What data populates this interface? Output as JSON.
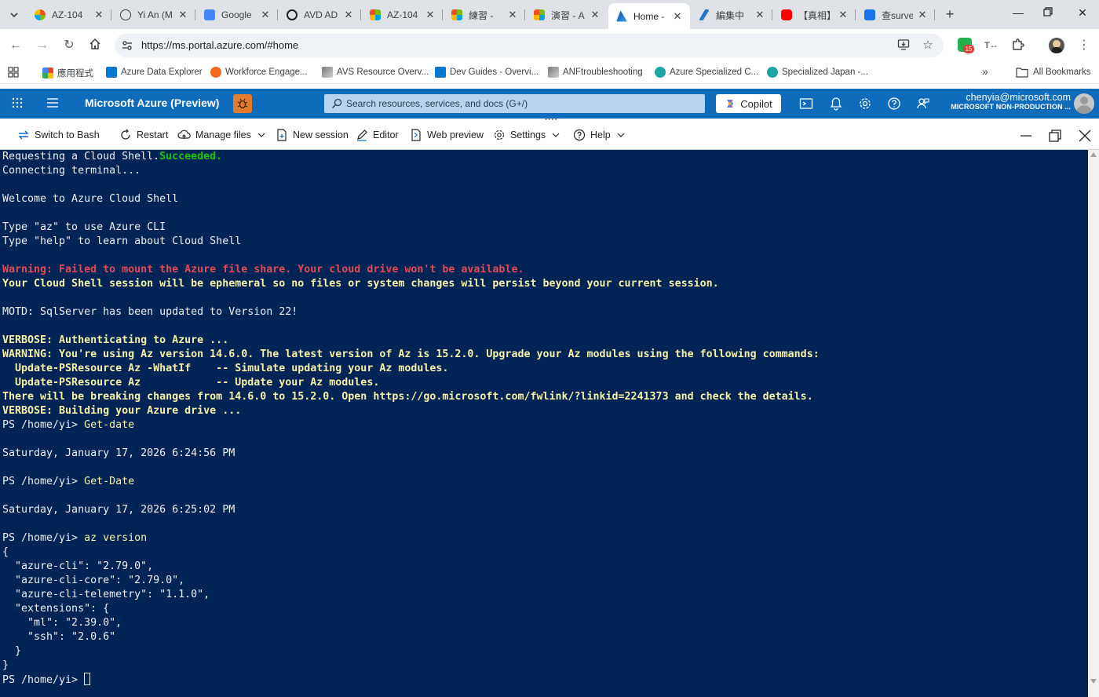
{
  "browser": {
    "tabs": [
      {
        "title": "AZ-104",
        "icon": "azure-multicolor-icon"
      },
      {
        "title": "Yi An (M",
        "icon": "globe-icon"
      },
      {
        "title": "Google",
        "icon": "google-translate-icon"
      },
      {
        "title": "AVD AD",
        "icon": "openai-icon"
      },
      {
        "title": "AZ-104",
        "icon": "microsoft-icon"
      },
      {
        "title": "練習 - ",
        "icon": "microsoft-icon"
      },
      {
        "title": "演習 - A",
        "icon": "microsoft-icon"
      },
      {
        "title": "Home -",
        "icon": "azure-icon",
        "active": true
      },
      {
        "title": "編集中",
        "icon": "azure-edit-icon"
      },
      {
        "title": "【真相】",
        "icon": "youtube-icon"
      },
      {
        "title": "查surve",
        "icon": "forms-icon"
      }
    ],
    "address": {
      "url": "https://ms.portal.azure.com/#home"
    },
    "extension_badge": "15",
    "bookmarks": [
      {
        "label": "應用程式",
        "icon": "apps-grid-icon"
      },
      {
        "label": "Azure Data Explorer",
        "icon": "azure-data-explorer-icon"
      },
      {
        "label": "Workforce Engage...",
        "icon": "workforce-icon"
      },
      {
        "label": "AVS Resource Overv...",
        "icon": "avs-icon"
      },
      {
        "label": "Dev Guides - Overvi...",
        "icon": "devops-icon"
      },
      {
        "label": "ANFtroubleshooting",
        "icon": "anf-icon"
      },
      {
        "label": "Azure Specialized C...",
        "icon": "teal-icon"
      },
      {
        "label": "Specialized Japan -...",
        "icon": "teal-icon"
      }
    ],
    "all_bookmarks_label": "All Bookmarks",
    "more_bookmarks": "»"
  },
  "azure": {
    "brand": "Microsoft Azure (Preview)",
    "search_placeholder": "Search resources, services, and docs (G+/)",
    "copilot_label": "Copilot",
    "user_email": "chenyia@microsoft.com",
    "tenant": "MICROSOFT NON-PRODUCTION ...",
    "colors": {
      "header_bg": "#0f6cbd",
      "terminal_bg": "#012456"
    }
  },
  "cloudshell": {
    "toolbar": {
      "switch": "Switch to Bash",
      "restart": "Restart",
      "manage_files": "Manage files",
      "new_session": "New session",
      "editor": "Editor",
      "web_preview": "Web preview",
      "settings": "Settings",
      "help": "Help"
    },
    "terminal": {
      "lines": [
        {
          "segments": [
            {
              "text": "Requesting a Cloud Shell.",
              "style": "default"
            },
            {
              "text": "Succeeded.",
              "style": "success"
            }
          ]
        },
        {
          "segments": [
            {
              "text": "Connecting terminal...",
              "style": "default"
            }
          ]
        },
        {
          "segments": [
            {
              "text": "",
              "style": "default"
            }
          ]
        },
        {
          "segments": [
            {
              "text": "Welcome to Azure Cloud Shell",
              "style": "default"
            }
          ]
        },
        {
          "segments": [
            {
              "text": "",
              "style": "default"
            }
          ]
        },
        {
          "segments": [
            {
              "text": "Type \"az\" to use Azure CLI",
              "style": "default"
            }
          ]
        },
        {
          "segments": [
            {
              "text": "Type \"help\" to learn about Cloud Shell",
              "style": "default"
            }
          ]
        },
        {
          "segments": [
            {
              "text": "",
              "style": "default"
            }
          ]
        },
        {
          "segments": [
            {
              "text": "Warning: Failed to mount the Azure file share. Your cloud drive won't be available.",
              "style": "red"
            }
          ]
        },
        {
          "segments": [
            {
              "text": "Your Cloud Shell session will be ephemeral so no files or system changes will persist beyond your current session.",
              "style": "yellow"
            }
          ]
        },
        {
          "segments": [
            {
              "text": "",
              "style": "default"
            }
          ]
        },
        {
          "segments": [
            {
              "text": "MOTD: SqlServer has been updated to Version 22!",
              "style": "default"
            }
          ]
        },
        {
          "segments": [
            {
              "text": "",
              "style": "default"
            }
          ]
        },
        {
          "segments": [
            {
              "text": "VERBOSE: Authenticating to Azure ...",
              "style": "yellow"
            }
          ]
        },
        {
          "segments": [
            {
              "text": "WARNING: You're using Az version 14.6.0. The latest version of Az is 15.2.0. Upgrade your Az modules using the following commands:",
              "style": "yellow"
            }
          ]
        },
        {
          "segments": [
            {
              "text": "  Update-PSResource Az -WhatIf    -- Simulate updating your Az modules.",
              "style": "yellow"
            }
          ]
        },
        {
          "segments": [
            {
              "text": "  Update-PSResource Az            -- Update your Az modules.",
              "style": "yellow"
            }
          ]
        },
        {
          "segments": [
            {
              "text": "There will be breaking changes from 14.6.0 to 15.2.0. Open https://go.microsoft.com/fwlink/?linkid=2241373 and check the details.",
              "style": "yellow"
            }
          ]
        },
        {
          "segments": [
            {
              "text": "VERBOSE: Building your Azure drive ...",
              "style": "yellow"
            }
          ]
        },
        {
          "segments": [
            {
              "text": "PS /home/yi> ",
              "style": "default"
            },
            {
              "text": "Get-date",
              "style": "cmd"
            }
          ]
        },
        {
          "segments": [
            {
              "text": "",
              "style": "default"
            }
          ]
        },
        {
          "segments": [
            {
              "text": "Saturday, January 17, 2026 6:24:56 PM",
              "style": "default"
            }
          ]
        },
        {
          "segments": [
            {
              "text": "",
              "style": "default"
            }
          ]
        },
        {
          "segments": [
            {
              "text": "PS /home/yi> ",
              "style": "default"
            },
            {
              "text": "Get-Date",
              "style": "cmd"
            }
          ]
        },
        {
          "segments": [
            {
              "text": "",
              "style": "default"
            }
          ]
        },
        {
          "segments": [
            {
              "text": "Saturday, January 17, 2026 6:25:02 PM",
              "style": "default"
            }
          ]
        },
        {
          "segments": [
            {
              "text": "",
              "style": "default"
            }
          ]
        },
        {
          "segments": [
            {
              "text": "PS /home/yi> ",
              "style": "default"
            },
            {
              "text": "az",
              "style": "cmd"
            },
            {
              "text": " version",
              "style": "verb"
            }
          ]
        },
        {
          "segments": [
            {
              "text": "{",
              "style": "default"
            }
          ]
        },
        {
          "segments": [
            {
              "text": "  \"azure-cli\": \"2.79.0\",",
              "style": "default"
            }
          ]
        },
        {
          "segments": [
            {
              "text": "  \"azure-cli-core\": \"2.79.0\",",
              "style": "default"
            }
          ]
        },
        {
          "segments": [
            {
              "text": "  \"azure-cli-telemetry\": \"1.1.0\",",
              "style": "default"
            }
          ]
        },
        {
          "segments": [
            {
              "text": "  \"extensions\": {",
              "style": "default"
            }
          ]
        },
        {
          "segments": [
            {
              "text": "    \"ml\": \"2.39.0\",",
              "style": "default"
            }
          ]
        },
        {
          "segments": [
            {
              "text": "    \"ssh\": \"2.0.6\"",
              "style": "default"
            }
          ]
        },
        {
          "segments": [
            {
              "text": "  }",
              "style": "default"
            }
          ]
        },
        {
          "segments": [
            {
              "text": "}",
              "style": "default"
            }
          ]
        },
        {
          "segments": [
            {
              "text": "PS /home/yi> ",
              "style": "default"
            }
          ],
          "cursor": true
        }
      ]
    }
  }
}
